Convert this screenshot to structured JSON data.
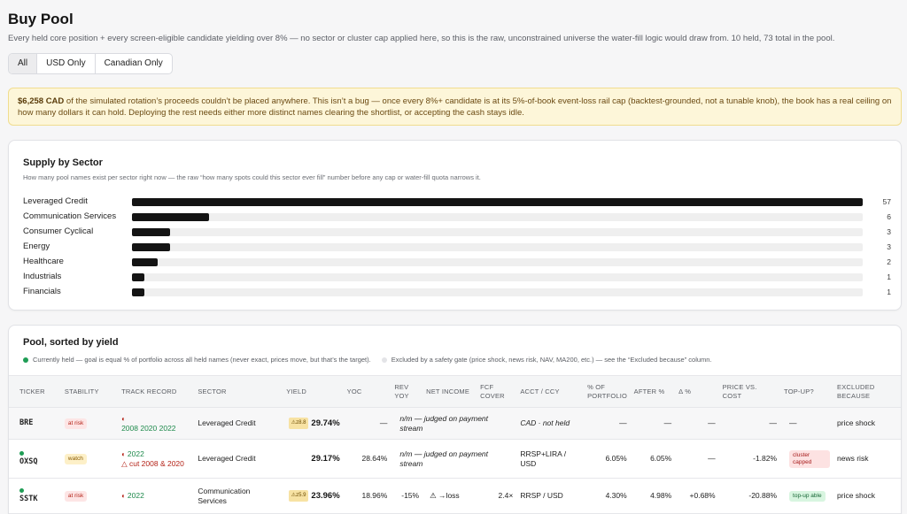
{
  "header": {
    "title": "Buy Pool",
    "subtitle": "Every held core position + every screen-eligible candidate yielding over 8% — no sector or cluster cap applied here, so this is the raw, unconstrained universe the water-fill logic would draw from. 10 held, 73 total in the pool."
  },
  "filters": [
    "All",
    "USD Only",
    "Canadian Only"
  ],
  "banner": {
    "amount": "$6,258 CAD",
    "text": " of the simulated rotation’s proceeds couldn’t be placed anywhere. This isn’t a bug — once every 8%+ candidate is at its 5%-of-book event-loss rail cap (backtest-grounded, not a tunable knob), the book has a real ceiling on how many dollars it can hold. Deploying the rest needs either more distinct names clearing the shortlist, or accepting the cash stays idle."
  },
  "sector_card": {
    "title": "Supply by Sector",
    "description": "How many pool names exist per sector right now — the raw “how many spots could this sector ever fill” number before any cap or water-fill quota narrows it.",
    "max": 57
  },
  "chart_data": {
    "type": "bar",
    "orientation": "horizontal",
    "title": "Supply by Sector",
    "categories": [
      "Leveraged Credit",
      "Communication Services",
      "Consumer Cyclical",
      "Energy",
      "Healthcare",
      "Industrials",
      "Financials"
    ],
    "values": [
      57,
      6,
      3,
      3,
      2,
      1,
      1
    ],
    "colors": {
      "bar": "#141414",
      "track": "#efefef"
    }
  },
  "pool_card": {
    "title": "Pool, sorted by yield",
    "legend_held": "Currently held — goal is equal % of portfolio across all held names (never exact, prices move, but that’s the target).",
    "legend_excluded": "Excluded by a safety gate (price shock, news risk, NAV, MA200, etc.) — see the “Excluded because” column."
  },
  "table": {
    "columns": [
      "TICKER",
      "STABILITY",
      "TRACK RECORD",
      "SECTOR",
      "YIELD",
      "YOC",
      "REV YOY",
      "NET INCOME",
      "FCF COVER",
      "ACCT / CCY",
      "% OF PORTFOLIO",
      "AFTER %",
      "Δ %",
      "PRICE VS. COST",
      "TOP-UP?",
      "EXCLUDED BECAUSE"
    ],
    "rows": [
      {
        "ticker": "BRE",
        "held": false,
        "stability": "at risk",
        "track": "2008 2020 2022",
        "sector": "Leveraged Credit",
        "yield_tag": "⚠z8.8",
        "yield": "29.74%",
        "yoc": "—",
        "rev_net": "n/m — judged on payment stream",
        "fcf": "",
        "acct": "CAD · not held",
        "pct": "—",
        "after": "—",
        "delta": "—",
        "price_vs_cost": "—",
        "topup": "—",
        "excluded": "price shock"
      },
      {
        "ticker": "OXSQ",
        "held": true,
        "stability": "watch",
        "track": "2022",
        "track_cut": "△ cut 2008 & 2020",
        "sector": "Leveraged Credit",
        "yield_tag": "",
        "yield": "29.17%",
        "yoc": "28.64%",
        "rev_net": "n/m — judged on payment stream",
        "fcf": "",
        "acct": "RRSP+LIRA / USD",
        "pct": "6.05%",
        "after": "6.05%",
        "delta": "—",
        "price_vs_cost": "-1.82%",
        "topup": "cluster capped",
        "excluded": "news risk"
      },
      {
        "ticker": "SSTK",
        "held": true,
        "stability": "at risk",
        "track": "2022",
        "sector": "Communication Services",
        "yield_tag": "⚠z5.9",
        "yield": "23.96%",
        "yoc": "18.96%",
        "rev": "-15%",
        "net": "⚠ →loss",
        "fcf": "2.4×",
        "acct": "RRSP / USD",
        "pct": "4.30%",
        "after": "4.98%",
        "delta": "+0.68%",
        "price_vs_cost": "-20.88%",
        "topup": "top-up able",
        "excluded": "price shock"
      }
    ]
  }
}
